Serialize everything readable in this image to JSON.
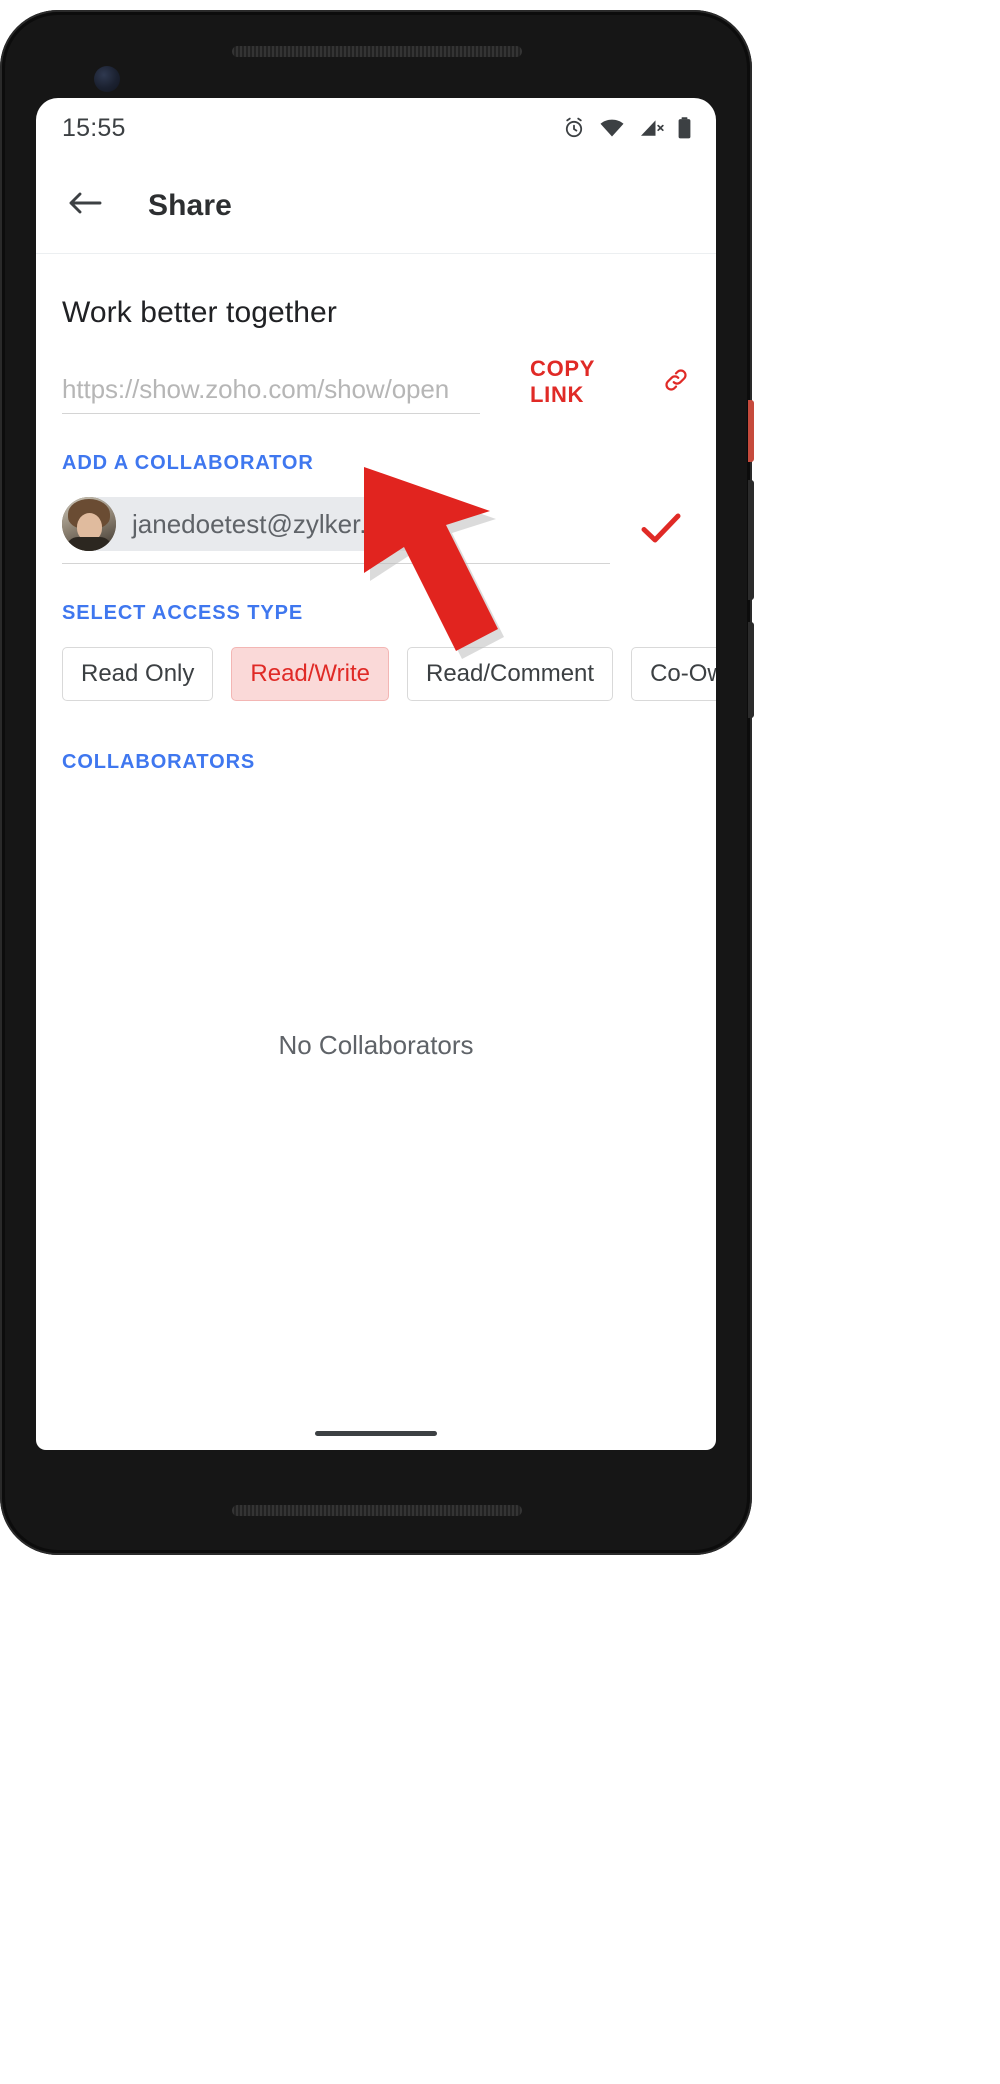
{
  "device": {
    "type": "android-phone-mockup",
    "frame_color": "#161616"
  },
  "status_bar": {
    "time": "15:55",
    "icons": [
      {
        "name": "alarm-icon",
        "glyph": "alarm"
      },
      {
        "name": "wifi-icon",
        "glyph": "wifi"
      },
      {
        "name": "cellular-signal-off-icon",
        "glyph": "signal-x"
      },
      {
        "name": "battery-icon",
        "glyph": "battery"
      }
    ]
  },
  "app_bar": {
    "back_icon": "back-arrow-icon",
    "title": "Share"
  },
  "main": {
    "headline": "Work better together",
    "share_link": {
      "value": "https://show.zoho.com/show/open",
      "placeholder": "https://show.zoho.com/show/open"
    },
    "copy_link": {
      "label": "COPY LINK",
      "icon": "link-icon",
      "color": "#e02a26"
    },
    "add_collaborator": {
      "section_label": "ADD A COLLABORATOR",
      "chip": {
        "email": "janedoetest@zylker.com",
        "avatar": "user-avatar"
      },
      "trailing_text": ",",
      "confirm_icon": "check-icon",
      "confirm_color": "#e02a26"
    },
    "access_type": {
      "section_label": "SELECT ACCESS TYPE",
      "options": [
        {
          "label": "Read Only",
          "selected": false
        },
        {
          "label": "Read/Write",
          "selected": true
        },
        {
          "label": "Read/Comment",
          "selected": false
        },
        {
          "label": "Co-Owner",
          "selected": false
        }
      ]
    },
    "collaborators": {
      "section_label": "COLLABORATORS",
      "empty_message": "No Collaborators"
    }
  },
  "annotation": {
    "type": "pointer-arrow",
    "color": "#e1241f",
    "points_at": "collaborator-email-chip"
  },
  "colors": {
    "accent_blue": "#3f77ef",
    "accent_red": "#e02a26",
    "chip_bg": "#e8eaed",
    "selected_bg": "#fad9d8"
  }
}
